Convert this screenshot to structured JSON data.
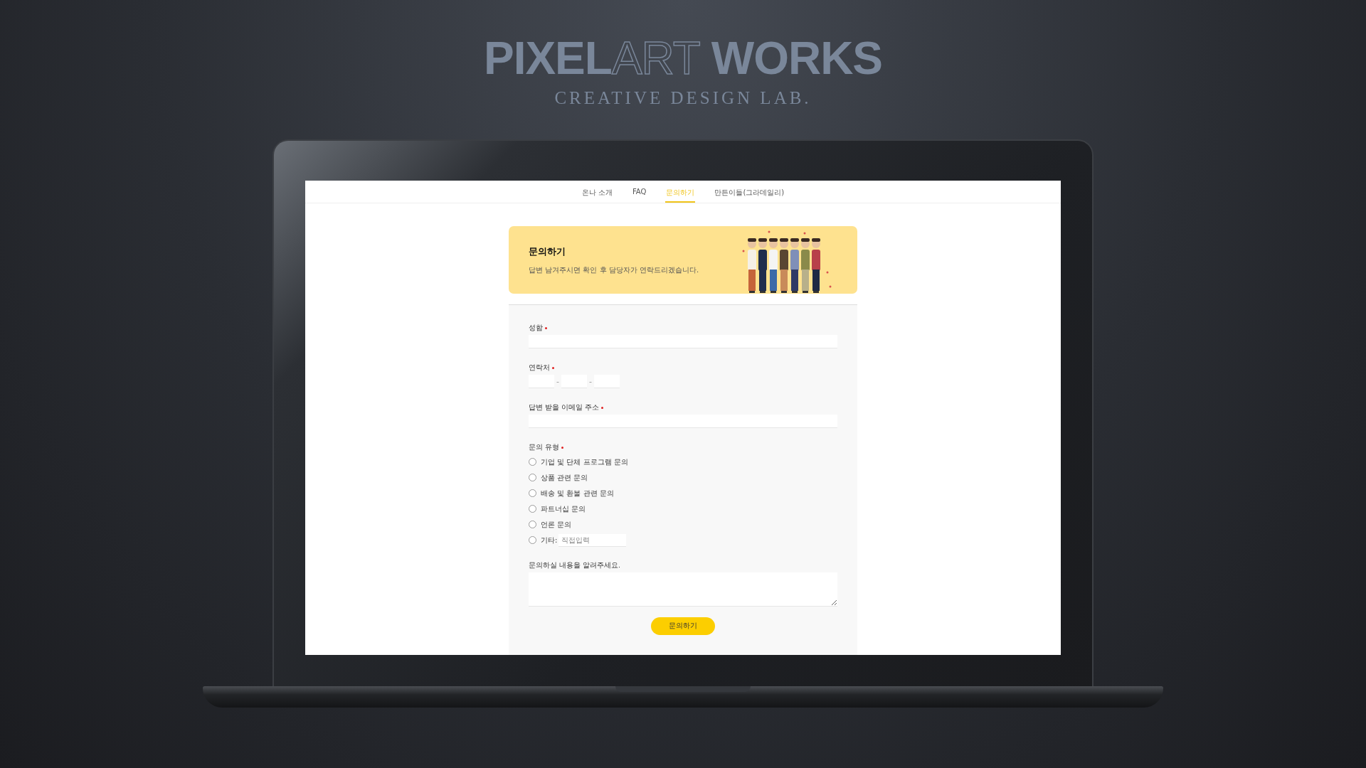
{
  "brand": {
    "title_solid": "PIXEL",
    "title_outline": "ART",
    "title_end": "WORKS",
    "tagline": "CREATIVE DESIGN LAB."
  },
  "nav": [
    {
      "label": "온나 소개",
      "selected": false
    },
    {
      "label": "FAQ",
      "selected": false
    },
    {
      "label": "문의하기",
      "selected": true
    },
    {
      "label": "만든이들(그라데일리)",
      "selected": false
    }
  ],
  "banner": {
    "title": "문의하기",
    "subtitle": "답변 남겨주시면 확인 후 담당자가 연락드리겠습니다."
  },
  "form": {
    "fields": [
      {
        "kind": "text",
        "label": "성함",
        "required": true
      },
      {
        "kind": "phone",
        "label": "연락처",
        "required": true,
        "separators": [
          "-",
          "-"
        ]
      },
      {
        "kind": "text",
        "label": "답변 받을 이메일 주소",
        "required": true
      },
      {
        "kind": "radio",
        "label": "문의 유형",
        "required": true,
        "options": [
          {
            "label": "기업 및 단체 프로그램 문의",
            "selected": false
          },
          {
            "label": "상품 관련 문의",
            "selected": false
          },
          {
            "label": "배송 및 환불 관련 문의",
            "selected": false
          },
          {
            "label": "파트너십 문의",
            "selected": false
          },
          {
            "label": "언론 문의",
            "selected": false
          },
          {
            "label": "기타:",
            "selected": false,
            "placeholder": "직접입력"
          }
        ]
      },
      {
        "kind": "textarea",
        "label": "문의하실 내용을 알려주세요.",
        "required": false
      }
    ],
    "submit": "문의하기"
  }
}
